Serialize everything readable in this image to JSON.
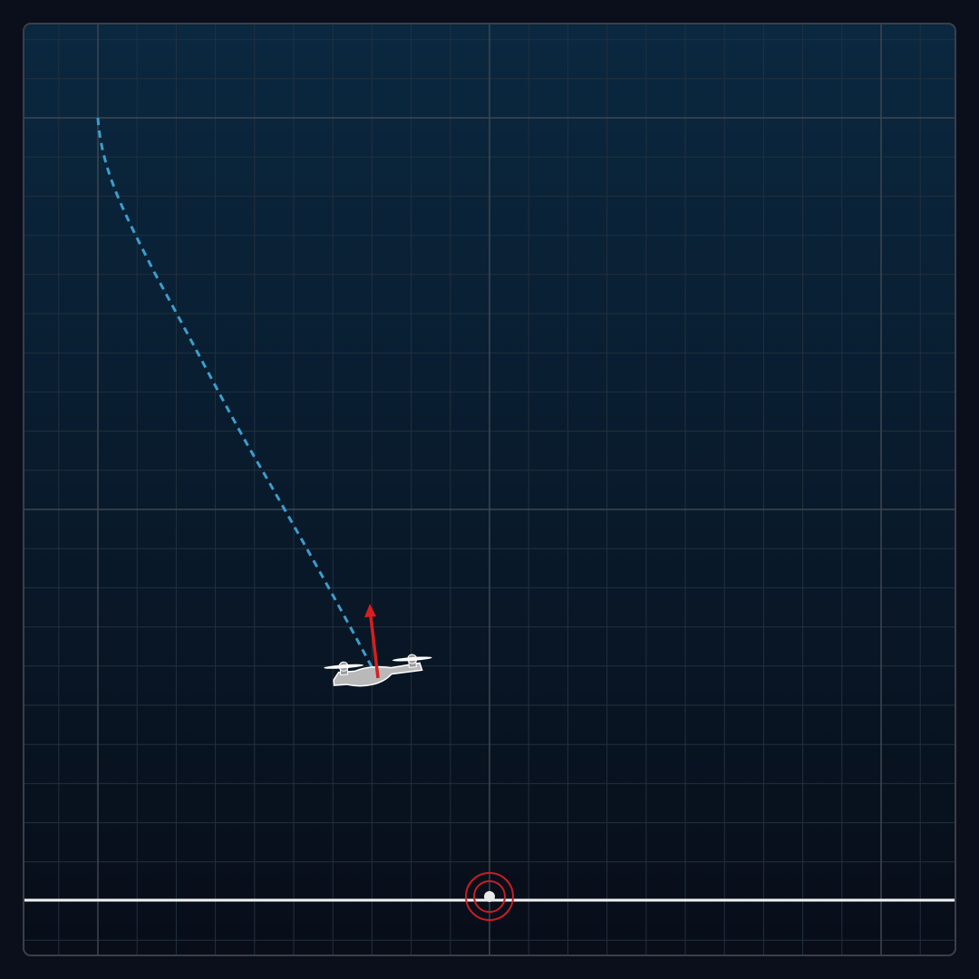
{
  "scene": {
    "type": "drone-landing-simulator"
  },
  "colors": {
    "background": "#0b0f1c",
    "sky_top": "#0a2840",
    "sky_bottom": "#080d18",
    "grid_minor": "#22303d",
    "grid_major": "#3e4650",
    "frame": "#3a3f48",
    "ground_line": "#f2f2f2",
    "trajectory": "#3c9dcc",
    "thrust_vector": "#d81e1e",
    "landing_pad": "#c81e24",
    "drone_body": "#b9b9b9"
  },
  "icons": {
    "drone": "quadcopter-icon",
    "thrust": "thrust-arrow-icon",
    "pad": "landing-target-icon"
  },
  "trajectory": {
    "style": "dashed"
  },
  "drone": {
    "tilt_deg": -4
  }
}
